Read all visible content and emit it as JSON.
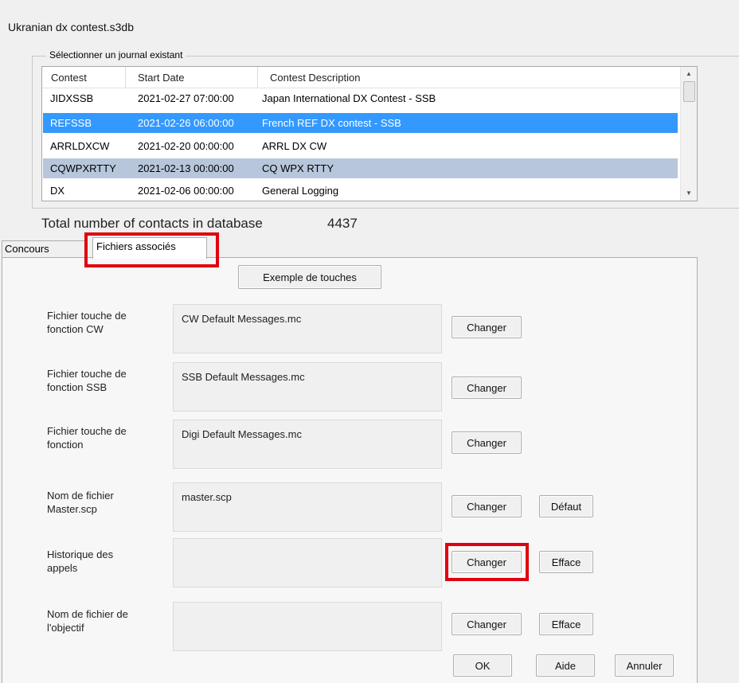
{
  "window": {
    "title": "Ukranian dx contest.s3db"
  },
  "journal": {
    "legend": "Sélectionner un journal existant",
    "columns": [
      "Contest",
      "Start Date",
      "Contest Description"
    ],
    "rows": [
      {
        "contest": "JIDXSSB",
        "start": "2021-02-27 07:00:00",
        "desc": "Japan International DX Contest - SSB"
      },
      {
        "contest": "REFSSB",
        "start": "2021-02-26 06:00:00",
        "desc": "French REF DX contest - SSB"
      },
      {
        "contest": "ARRLDXCW",
        "start": "2021-02-20 00:00:00",
        "desc": "ARRL DX CW"
      },
      {
        "contest": "CQWPXRTTY",
        "start": "2021-02-13 00:00:00",
        "desc": "CQ WPX RTTY"
      },
      {
        "contest": "DX",
        "start": "2021-02-06 00:00:00",
        "desc": "General Logging"
      }
    ]
  },
  "total": {
    "label": "Total number of contacts in database",
    "value": "4437"
  },
  "tabs": [
    {
      "label": "Concours"
    },
    {
      "label": "Fichiers associés"
    }
  ],
  "panel": {
    "example_button": "Exemple de touches",
    "files": [
      {
        "label": "Fichier touche de fonction CW",
        "value": "CW Default Messages.mc",
        "buttons": [
          "Changer"
        ]
      },
      {
        "label": "Fichier touche de fonction SSB",
        "value": "SSB Default Messages.mc",
        "buttons": [
          "Changer"
        ]
      },
      {
        "label": "Fichier touche de fonction",
        "value": "Digi Default Messages.mc",
        "buttons": [
          "Changer"
        ]
      },
      {
        "label": "Nom de fichier Master.scp",
        "value": "master.scp",
        "buttons": [
          "Changer",
          "Défaut"
        ]
      },
      {
        "label": "Historique des appels",
        "value": "",
        "buttons": [
          "Changer",
          "Efface"
        ]
      },
      {
        "label": "Nom de fichier de l'objectif",
        "value": "",
        "buttons": [
          "Changer",
          "Efface"
        ]
      }
    ],
    "ok": "OK",
    "help": "Aide",
    "cancel": "Annuler"
  },
  "colors": {
    "selection": "#3399ff",
    "secondary_selection": "#b7c6db",
    "highlight_box": "#e0000f"
  }
}
